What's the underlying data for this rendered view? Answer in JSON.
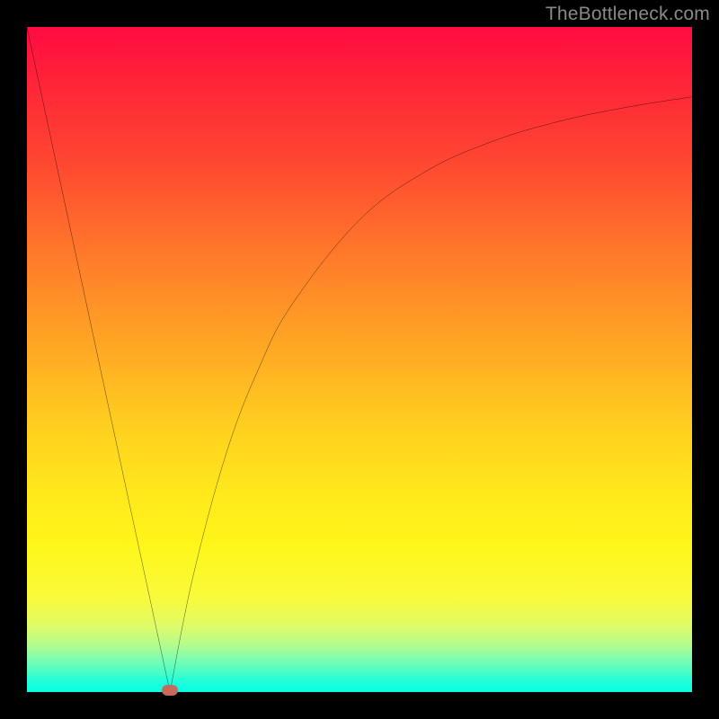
{
  "watermark": "TheBottleneck.com",
  "chart_data": {
    "type": "line",
    "title": "",
    "xlabel": "",
    "ylabel": "",
    "xlim": [
      0,
      100
    ],
    "ylim": [
      0,
      100
    ],
    "grid": false,
    "background": "vertical-gradient-red-to-green",
    "series": [
      {
        "name": "curve-left",
        "x": [
          0,
          6.25,
          12.5,
          18.75,
          21.5
        ],
        "values": [
          100,
          70.9,
          41.8,
          12.8,
          0
        ]
      },
      {
        "name": "curve-right",
        "x": [
          21.5,
          25,
          30,
          35,
          40,
          50,
          60,
          70,
          80,
          90,
          100
        ],
        "values": [
          0,
          17.5,
          36,
          49,
          58.5,
          71,
          78.3,
          82.8,
          85.8,
          87.9,
          89.5
        ]
      }
    ],
    "annotations": [
      {
        "name": "min-marker",
        "x": 21.5,
        "y": 0,
        "shape": "rounded-dot",
        "color": "#c76b5d"
      }
    ]
  }
}
